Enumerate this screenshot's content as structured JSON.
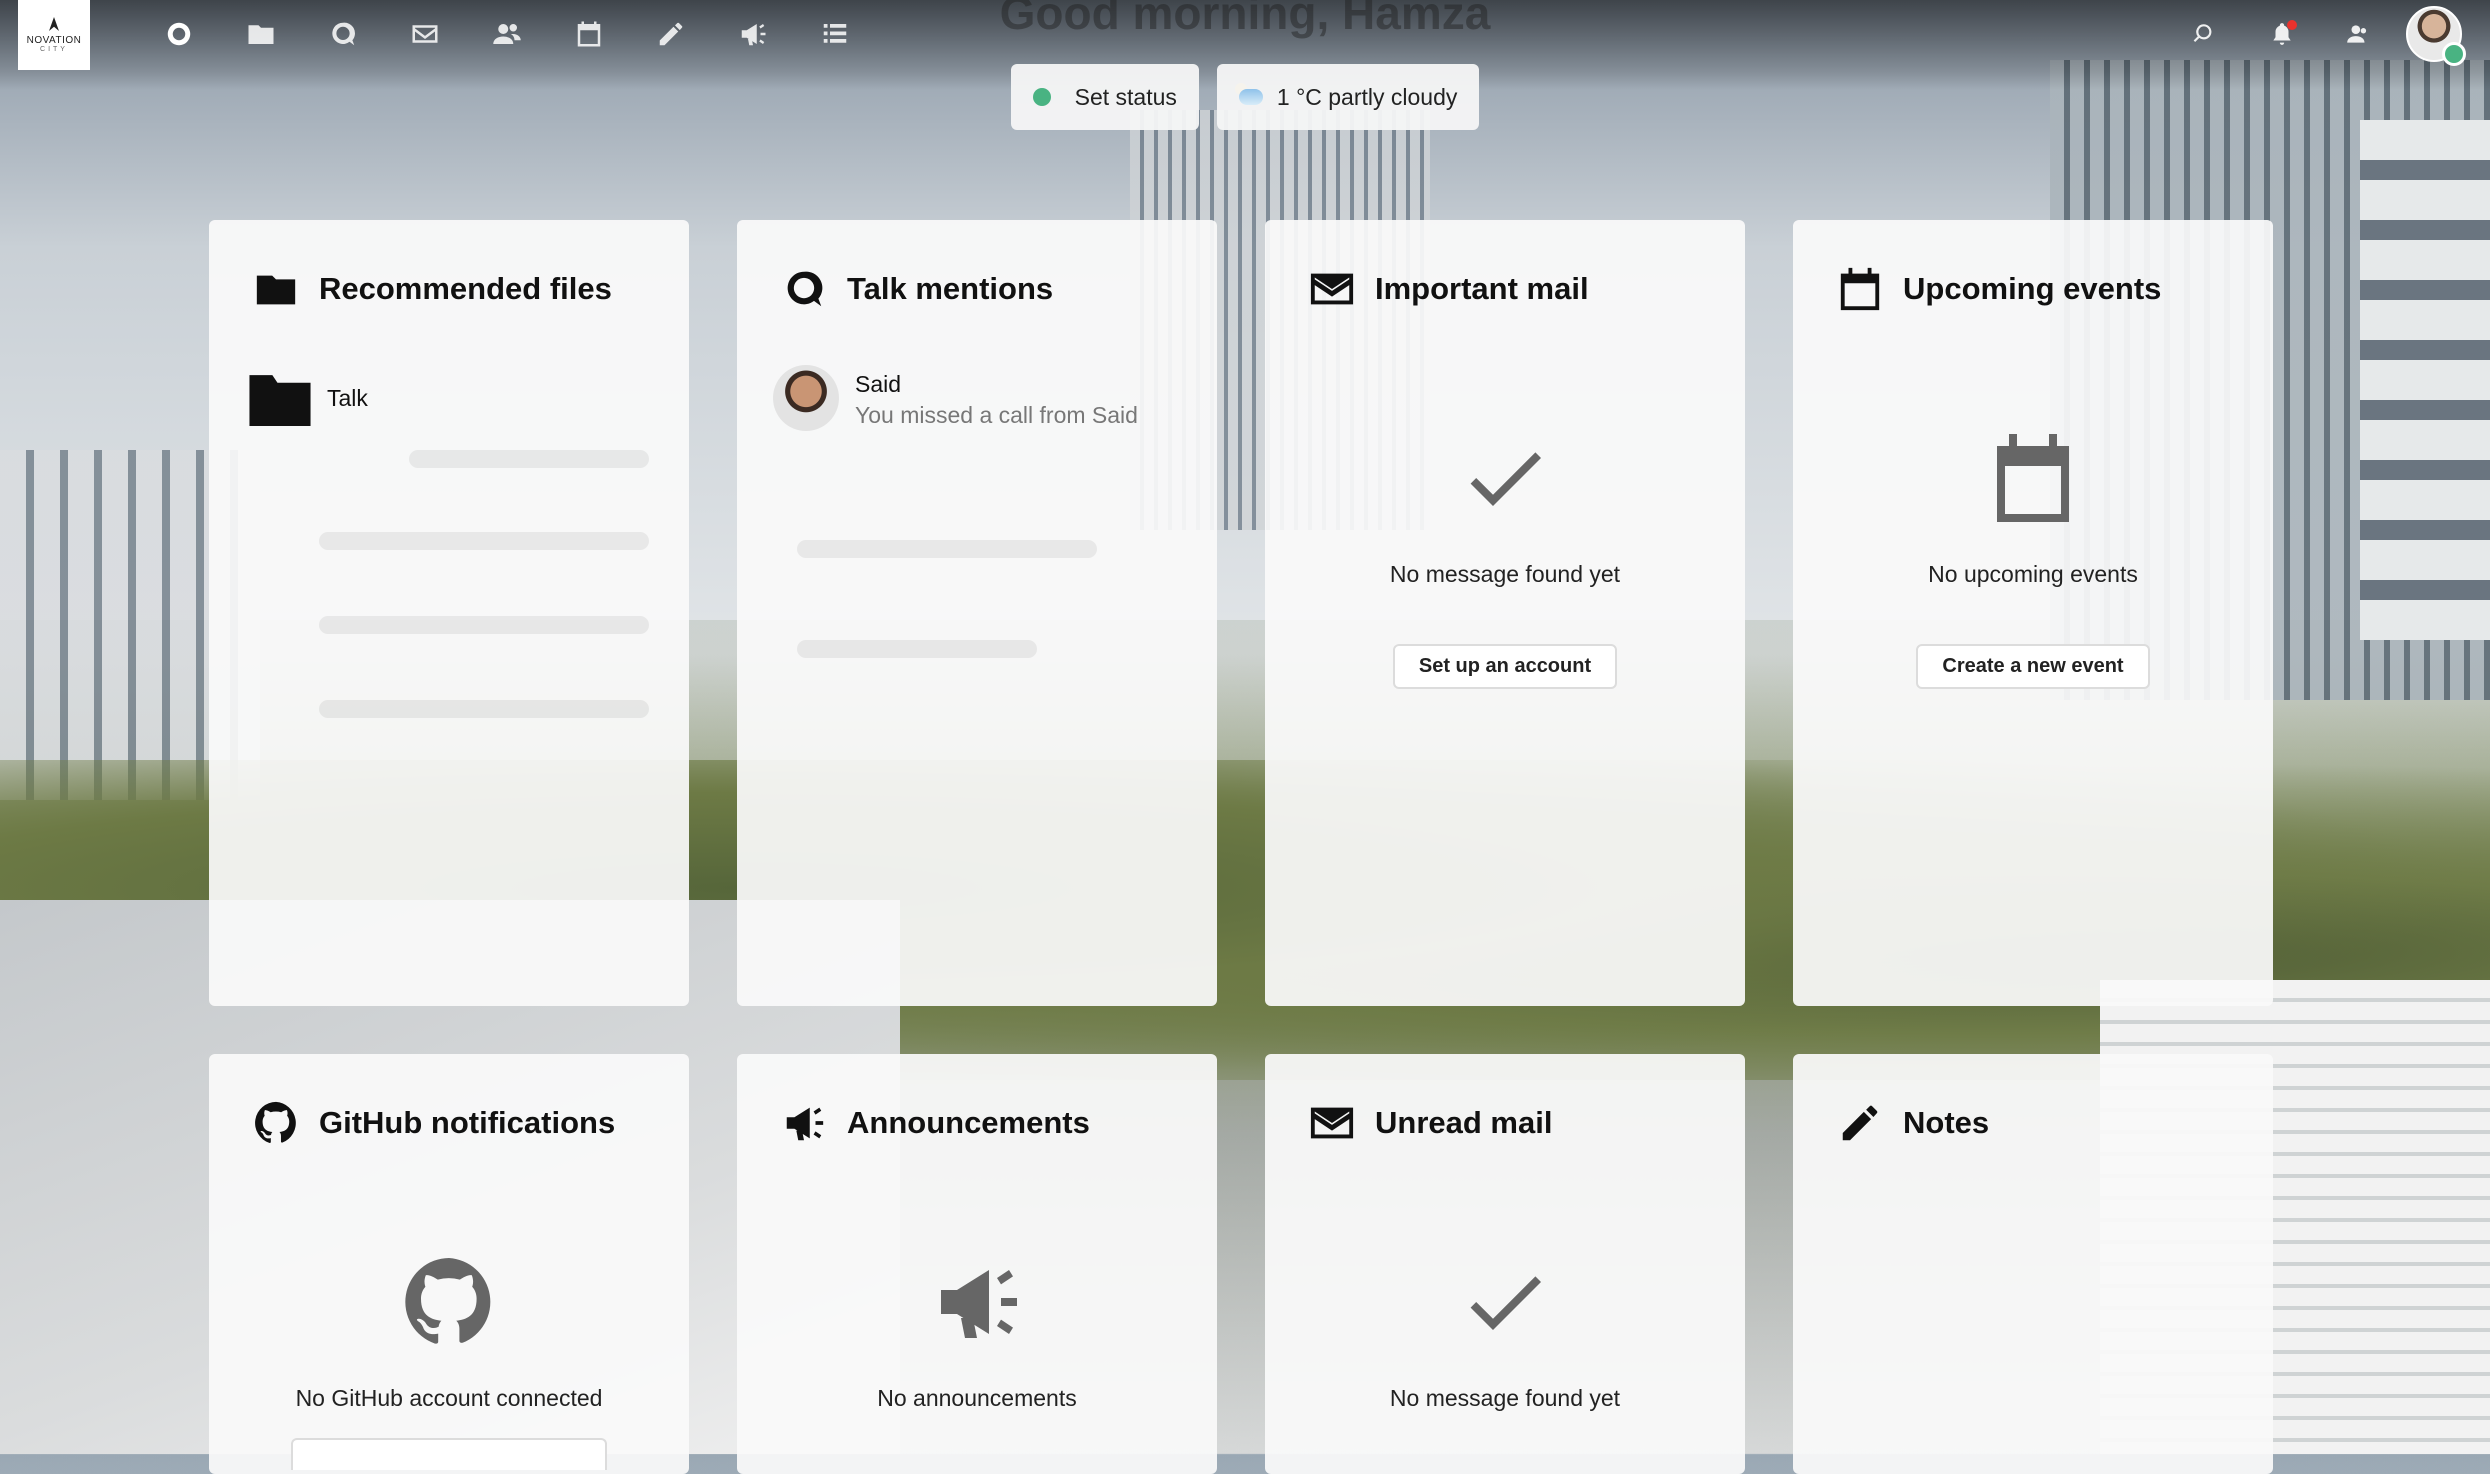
{
  "header": {
    "logo_line1": "NOVATION",
    "logo_line2": "CITY",
    "apps": [
      {
        "name": "dashboard-app"
      },
      {
        "name": "files-app"
      },
      {
        "name": "talk-app"
      },
      {
        "name": "mail-app"
      },
      {
        "name": "contacts-app"
      },
      {
        "name": "calendar-app"
      },
      {
        "name": "notes-app"
      },
      {
        "name": "announcements-app"
      },
      {
        "name": "tasks-app"
      }
    ]
  },
  "greeting": "Good morning, Hamza",
  "status": {
    "set_status_label": "Set status",
    "weather_label": "1 °C partly cloudy"
  },
  "panels": {
    "recommended_files": {
      "title": "Recommended files",
      "items": [
        {
          "label": "Talk"
        }
      ]
    },
    "talk_mentions": {
      "title": "Talk mentions",
      "items": [
        {
          "name": "Said",
          "subtitle": "You missed a call from Said"
        }
      ]
    },
    "important_mail": {
      "title": "Important mail",
      "empty_text": "No message found yet",
      "button": "Set up an account"
    },
    "upcoming_events": {
      "title": "Upcoming events",
      "empty_text": "No upcoming events",
      "button": "Create a new event"
    },
    "github": {
      "title": "GitHub notifications",
      "empty_text": "No GitHub account connected"
    },
    "announcements": {
      "title": "Announcements",
      "empty_text": "No announcements"
    },
    "unread_mail": {
      "title": "Unread mail",
      "empty_text": "No message found yet"
    },
    "notes": {
      "title": "Notes"
    }
  },
  "colors": {
    "online": "#49b382",
    "notification_dot": "#e9322d",
    "panel_bg": "#fafafa"
  }
}
